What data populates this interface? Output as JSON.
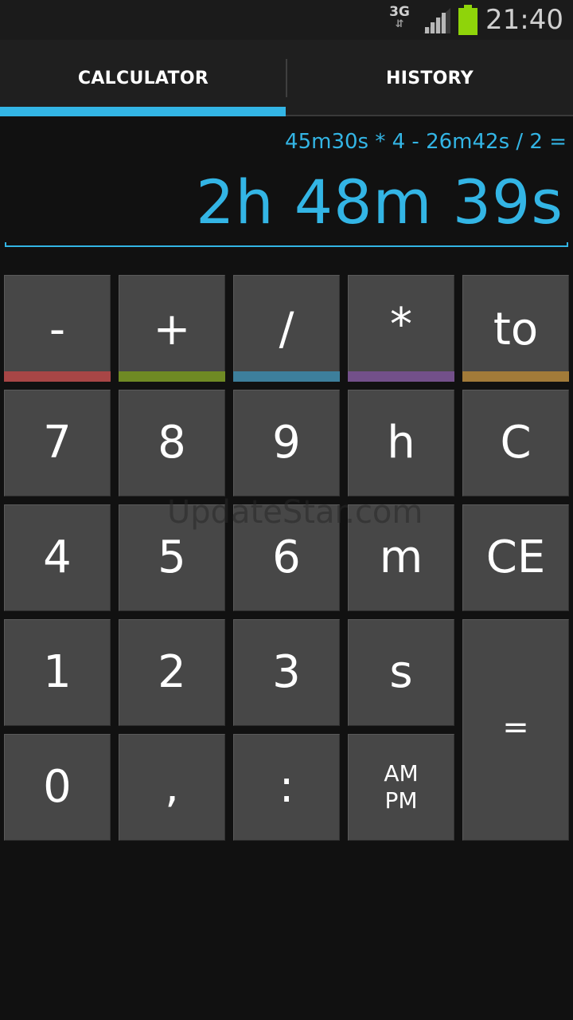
{
  "status_bar": {
    "network": "3G",
    "network_arrows": "⇵",
    "time": "21:40",
    "battery_color": "#8fd40a"
  },
  "tabs": {
    "calculator": "CALCULATOR",
    "history": "HISTORY",
    "accent": "#33b5e5"
  },
  "display": {
    "expression": "45m30s * 4 - 26m42s / 2 =",
    "result": "2h 48m 39s"
  },
  "keys": {
    "minus": "-",
    "plus": "+",
    "divide": "/",
    "multiply": "*",
    "to": "to",
    "seven": "7",
    "eight": "8",
    "nine": "9",
    "hours": "h",
    "clear": "C",
    "four": "4",
    "five": "5",
    "six": "6",
    "minutes": "m",
    "clear_entry": "CE",
    "one": "1",
    "two": "2",
    "three": "3",
    "seconds": "s",
    "equals": "=",
    "zero": "0",
    "comma": ",",
    "colon": ":",
    "ampm": "AM\nPM"
  },
  "operator_colors": {
    "minus": "#a84646",
    "plus": "#6f8a24",
    "divide": "#3d7f9c",
    "multiply": "#73508a",
    "to": "#a27b39"
  },
  "watermark": "UpdateStar.com"
}
